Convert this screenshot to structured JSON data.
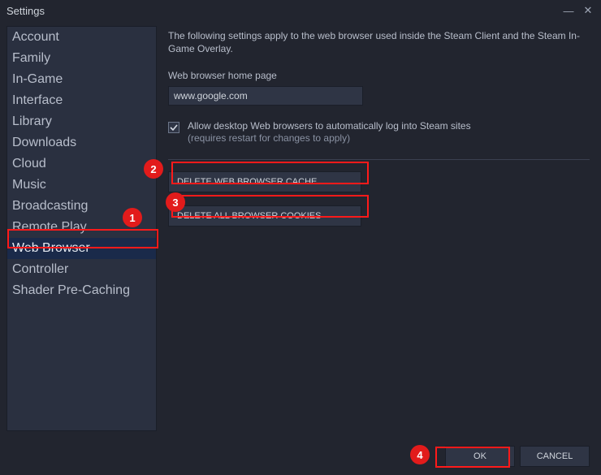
{
  "window": {
    "title": "Settings"
  },
  "sidebar": {
    "items": [
      {
        "label": "Account"
      },
      {
        "label": "Family"
      },
      {
        "label": "In-Game"
      },
      {
        "label": "Interface"
      },
      {
        "label": "Library"
      },
      {
        "label": "Downloads"
      },
      {
        "label": "Cloud"
      },
      {
        "label": "Music"
      },
      {
        "label": "Broadcasting"
      },
      {
        "label": "Remote Play"
      },
      {
        "label": "Web Browser",
        "selected": true
      },
      {
        "label": "Controller"
      },
      {
        "label": "Shader Pre-Caching"
      }
    ]
  },
  "content": {
    "description": "The following settings apply to the web browser used inside the Steam Client and the Steam In-Game Overlay.",
    "homepage_label": "Web browser home page",
    "homepage_value": "www.google.com",
    "checkbox": {
      "checked": true,
      "label": "Allow desktop Web browsers to automatically log into Steam sites",
      "sublabel": "(requires restart for changes to apply)"
    },
    "delete_cache_label": "DELETE WEB BROWSER CACHE",
    "delete_cookies_label": "DELETE ALL BROWSER COOKIES"
  },
  "footer": {
    "ok": "OK",
    "cancel": "CANCEL"
  },
  "annotations": {
    "b1": "1",
    "b2": "2",
    "b3": "3",
    "b4": "4"
  }
}
